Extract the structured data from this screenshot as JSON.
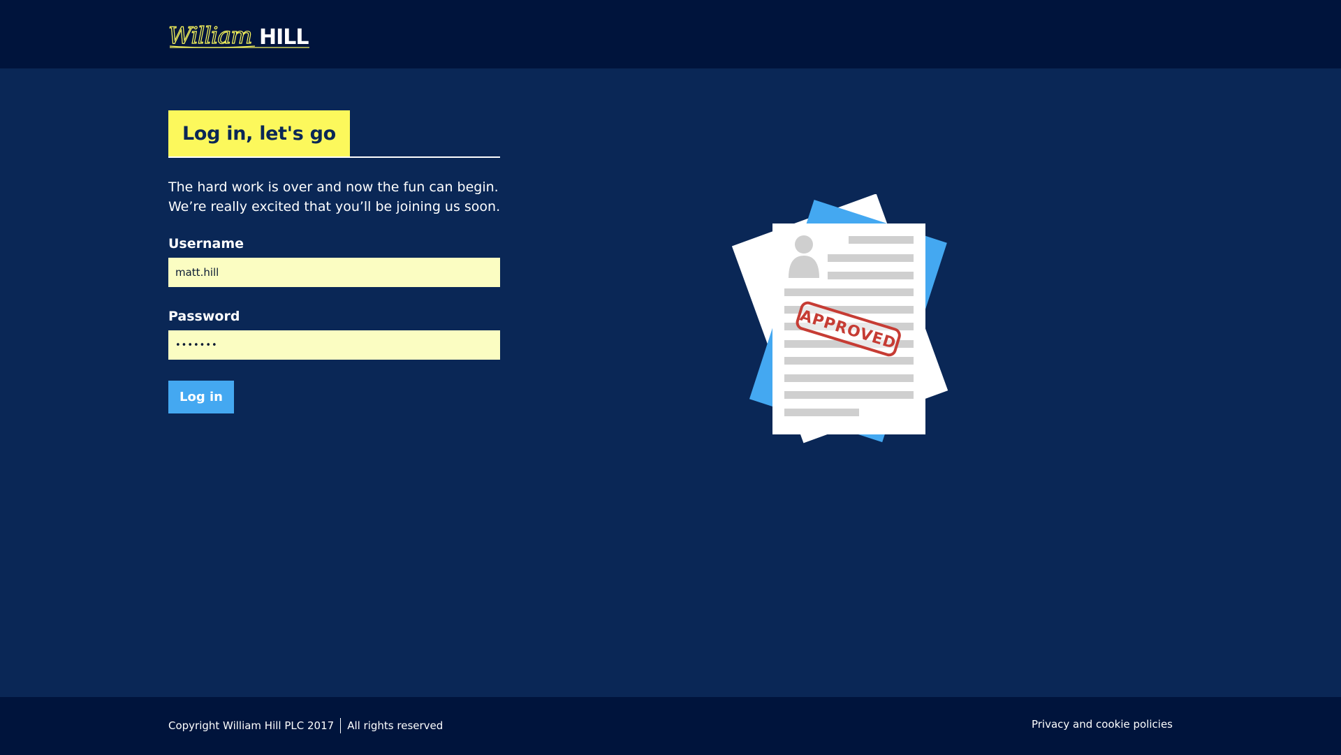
{
  "brand": {
    "logo_script": "William",
    "logo_block": "HILL"
  },
  "login": {
    "heading": "Log in, let's go",
    "intro_line1": "The hard work is over and now the fun can begin.",
    "intro_line2": "We’re really excited that you’ll be joining us soon.",
    "username_label": "Username",
    "username_value": "matt.hill",
    "password_label": "Password",
    "password_value": "•••••••",
    "submit_label": "Log in"
  },
  "illustration": {
    "stamp_text": "APPROVED",
    "icon": "approved-document-icon"
  },
  "footer": {
    "copyright": "Copyright William Hill PLC 2017",
    "rights": "All rights reserved",
    "privacy_link": "Privacy and cookie policies"
  },
  "colors": {
    "header_bg": "#00143c",
    "page_bg": "#0a2756",
    "heading_bg": "#fcf85c",
    "input_bg": "#fbfdc2",
    "button_bg": "#44a8f1",
    "stamp": "#c63c34"
  }
}
